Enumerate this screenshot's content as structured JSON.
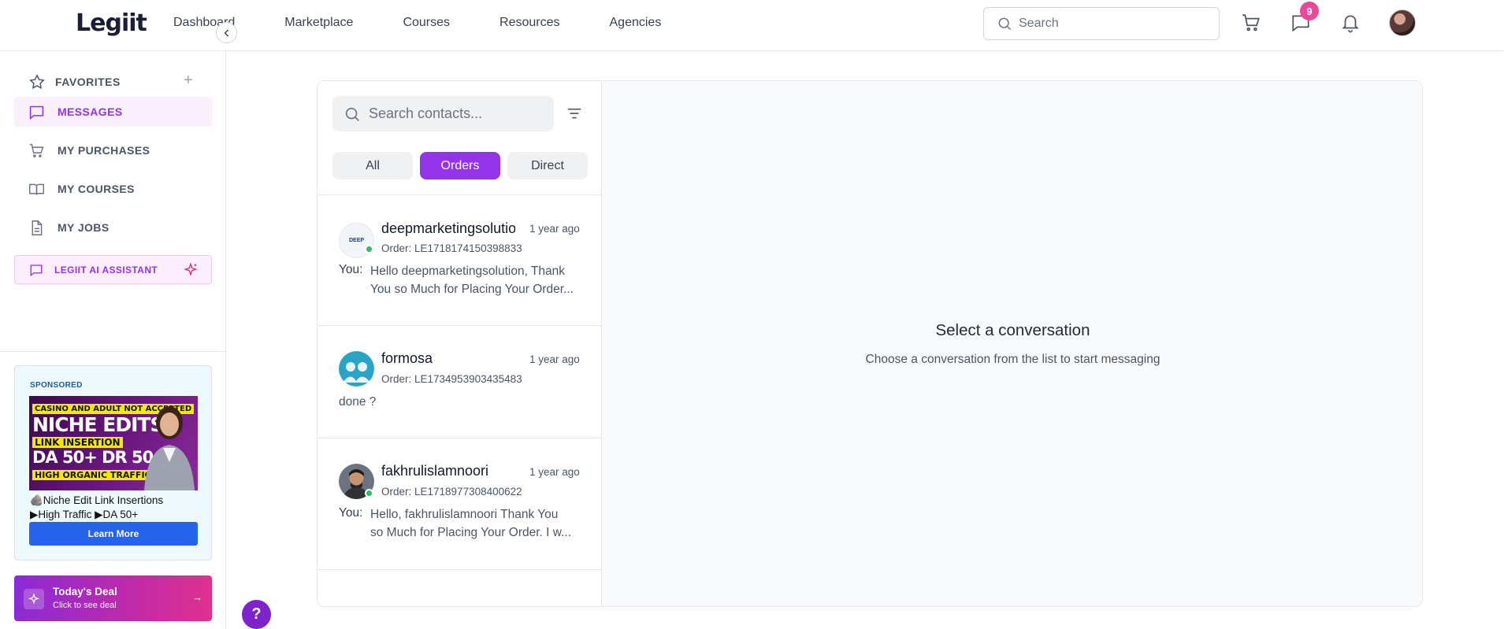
{
  "header": {
    "logo": "Legiit",
    "nav": [
      "Dashboard",
      "Marketplace",
      "Courses",
      "Resources",
      "Agencies"
    ],
    "search_placeholder": "Search",
    "message_badge": "9"
  },
  "sidebar": {
    "favorites_label": "FAVORITES",
    "items": [
      {
        "label": "MESSAGES",
        "icon": "message-icon",
        "active": true
      },
      {
        "label": "MY PURCHASES",
        "icon": "cart-icon"
      },
      {
        "label": "MY COURSES",
        "icon": "book-icon"
      },
      {
        "label": "MY JOBS",
        "icon": "document-icon"
      }
    ],
    "ai_assistant_label": "LEGIIT AI ASSISTANT",
    "sponsored": {
      "tag": "SPONSORED",
      "image_lines": [
        "CASINO AND ADULT NOT ACCEPTED",
        "NICHE EDITS",
        "LINK INSERTION",
        "DA 50+ DR 50+",
        "HIGH ORGANIC TRAFFIC"
      ],
      "title_line1": "🪨Niche Edit Link Insertions",
      "title_line2": "▶High Traffic ▶DA 50+",
      "button": "Learn More"
    },
    "deal": {
      "title": "Today's Deal",
      "subtitle": "Click to see deal"
    },
    "help": "?"
  },
  "messages": {
    "search_placeholder": "Search contacts...",
    "tabs": [
      {
        "label": "All",
        "active": false
      },
      {
        "label": "Orders",
        "active": true
      },
      {
        "label": "Direct",
        "active": false
      }
    ],
    "conversations": [
      {
        "name": "deepmarketingsolution",
        "time": "1 year ago",
        "order": "Order: LE1718174150398833",
        "prefix": "You:",
        "message_line1": "Hello deepmarketingsolution, Thank",
        "message_line2": "You so Much for Placing Your Order...",
        "online": true,
        "avatar_text": "DEEP"
      },
      {
        "name": "formosa",
        "time": "1 year ago",
        "order": "Order: LE1734953903435483",
        "prefix": "",
        "message_line1": "done ?",
        "message_line2": "",
        "online": false
      },
      {
        "name": "fakhrulislamnoori",
        "time": "1 year ago",
        "order": "Order: LE1718977308400622",
        "prefix": "You:",
        "message_line1": "Hello, fakhrulislamnoori Thank You",
        "message_line2": "so Much for Placing Your Order. I w...",
        "online": true
      }
    ],
    "empty_title": "Select a conversation",
    "empty_subtitle": "Choose a conversation from the list to start messaging"
  },
  "colors": {
    "accent": "#9333ea",
    "badge": "#ec4899",
    "learn_button": "#2563eb",
    "online": "#22c55e"
  }
}
